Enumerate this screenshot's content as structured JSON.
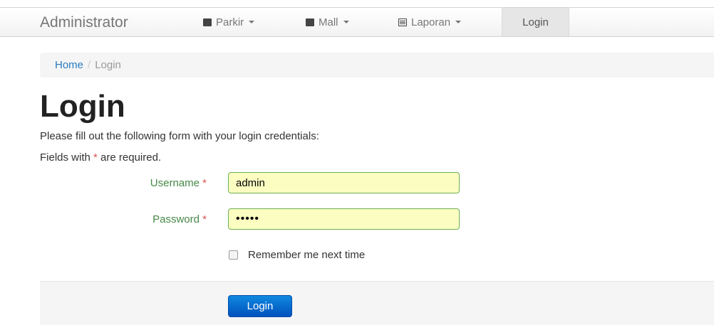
{
  "navbar": {
    "brand": "Administrator",
    "items": [
      {
        "label": "Parkir",
        "icon": "book-icon"
      },
      {
        "label": "Mall",
        "icon": "book-icon"
      },
      {
        "label": "Laporan",
        "icon": "list-icon"
      }
    ],
    "active_item": "Login"
  },
  "breadcrumb": {
    "home": "Home",
    "separator": "/",
    "current": "Login"
  },
  "page": {
    "title": "Login",
    "intro": "Please fill out the following form with your login credentials:",
    "required_prefix": "Fields with",
    "required_star": "*",
    "required_suffix": "are required."
  },
  "form": {
    "username_label": "Username",
    "username_value": "admin",
    "password_label": "Password",
    "password_value": "•••••",
    "required_star": "*",
    "remember_label": "Remember me next time",
    "submit_label": "Login"
  },
  "colors": {
    "label_green": "#468847",
    "required_red": "#d9534f",
    "link_blue": "#2a7bc0",
    "button_blue": "#0f89e0",
    "input_fill": "#fbfdc1"
  }
}
